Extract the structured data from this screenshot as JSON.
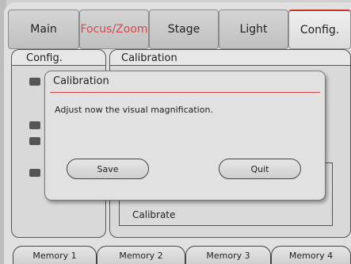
{
  "tabs": [
    {
      "label": "Main"
    },
    {
      "label": "Focus/Zoom"
    },
    {
      "label": "Stage"
    },
    {
      "label": "Light"
    },
    {
      "label": "Config."
    }
  ],
  "colors": {
    "accent": "#c0392b",
    "focus_tab_text": "#d44a4a"
  },
  "panels": {
    "left_title": "Config.",
    "right_title": "Calibration",
    "calibrate_label": "Calibrate"
  },
  "dialog": {
    "title": "Calibration",
    "message": "Adjust now the visual magnification.",
    "save_label": "Save",
    "quit_label": "Quit"
  },
  "memory": [
    {
      "label": "Memory 1"
    },
    {
      "label": "Memory 2"
    },
    {
      "label": "Memory 3"
    },
    {
      "label": "Memory 4"
    }
  ]
}
